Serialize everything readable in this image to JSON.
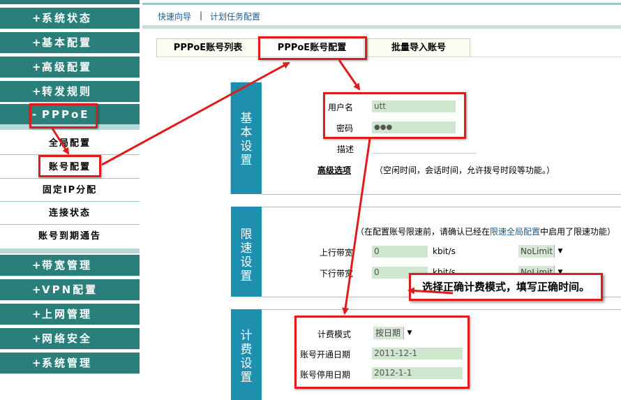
{
  "sidebar": {
    "menu": [
      {
        "label": "系统状态",
        "plus": "+"
      },
      {
        "label": "基本配置",
        "plus": "+"
      },
      {
        "label": "高级配置",
        "plus": "+"
      },
      {
        "label": "转发规则",
        "plus": "+"
      },
      {
        "label": "PPPoE",
        "plus": "-"
      }
    ],
    "submenu": [
      "全局配置",
      "账号配置",
      "固定IP分配",
      "连接状态",
      "账号到期通告"
    ],
    "menu_bottom": [
      {
        "label": "带宽管理",
        "plus": "+"
      },
      {
        "label": "VPN配置",
        "plus": "+"
      },
      {
        "label": "上网管理",
        "plus": "+"
      },
      {
        "label": "网络安全",
        "plus": "+"
      },
      {
        "label": "系统管理",
        "plus": "+"
      }
    ]
  },
  "nav": {
    "quick": "快速向导",
    "sep": "|",
    "schedule": "计划任务配置"
  },
  "tabs": [
    "PPPoE账号列表",
    "PPPoE账号配置",
    "批量导入账号"
  ],
  "basic": {
    "title": "基本设置",
    "username_label": "用户名",
    "username_value": "utt",
    "password_label": "密码",
    "password_value": "●●●",
    "desc_label": "描述",
    "advanced_label": "高级选项",
    "advanced_note": "（空闲时间，会话时间，允许拨号时段等功能。）"
  },
  "rate": {
    "title": "限速设置",
    "note_prefix": "（在配置账号限速前，请确认已经在",
    "note_link": "限速全局配置",
    "note_suffix": "中启用了限速功能）",
    "up_label": "上行带宽",
    "up_value": "0",
    "up_unit": "kbit/s",
    "up_select": "NoLimit",
    "down_label": "下行带宽",
    "down_value": "0",
    "down_unit": "kbit/s",
    "down_select": "NoLimit"
  },
  "billing": {
    "title": "计费设置",
    "mode_label": "计费模式",
    "mode_value": "按日期",
    "start_label": "账号开通日期",
    "start_value": "2011-12-1",
    "end_label": "账号停用日期",
    "end_value": "2012-1-1"
  },
  "callout": "选择正确计费模式，填写正确时间。",
  "colors": {
    "accent": "#2a7f7b",
    "section": "#1f8fb0",
    "annotation": "#e01b1b",
    "field": "#cfe6cf"
  }
}
